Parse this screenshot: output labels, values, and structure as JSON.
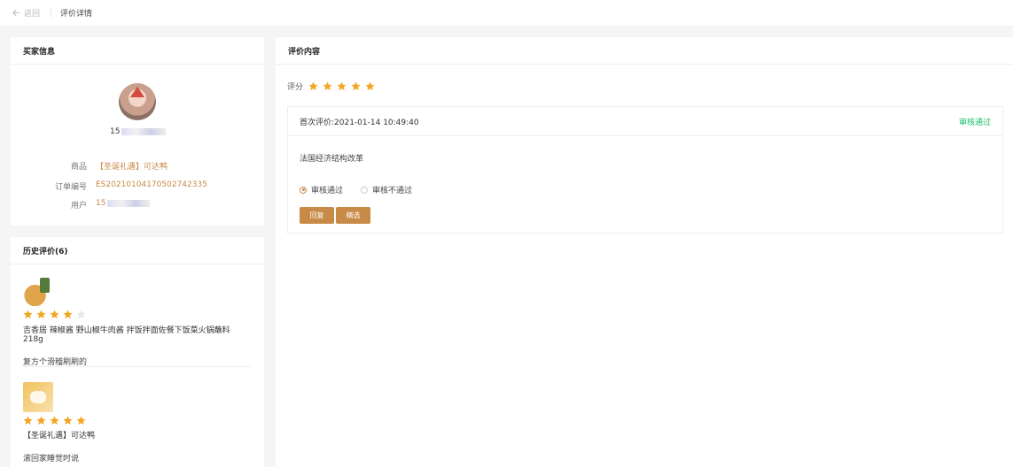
{
  "header": {
    "back_label": "返回",
    "title": "评价详情"
  },
  "buyer": {
    "title": "买家信息",
    "phone_prefix": "15",
    "rows": [
      {
        "label": "商品",
        "value": "【圣诞礼遇】可达鸭"
      },
      {
        "label": "订单编号",
        "value": "ES20210104170502742335"
      },
      {
        "label": "用户",
        "value": "15"
      }
    ]
  },
  "history": {
    "title": "历史评价(6)",
    "items": [
      {
        "rating": 4,
        "product": "吉香居 辣椒酱 野山椒牛肉酱 拌饭拌面佐餐下饭菜火锅蘸料 218g",
        "comment": "复方个滑稽刷刷的"
      },
      {
        "rating": 5,
        "product": "【圣诞礼遇】可达鸭",
        "comment": "滚回家睡觉时说"
      }
    ]
  },
  "review": {
    "title": "评价内容",
    "score_label": "评分",
    "score": 5,
    "first_review": "首次评价:2021-01-14 10:49:40",
    "status": "审核通过",
    "content": "法国经济结构改革",
    "radio_pass": "审核通过",
    "radio_fail": "审核不通过",
    "selected": "pass",
    "btn_reply": "回复",
    "btn_pick": "精选"
  },
  "colors": {
    "accent": "#c88a47",
    "star": "#f5a623",
    "star_empty": "#e8e8e8",
    "pass": "#19be6b"
  }
}
